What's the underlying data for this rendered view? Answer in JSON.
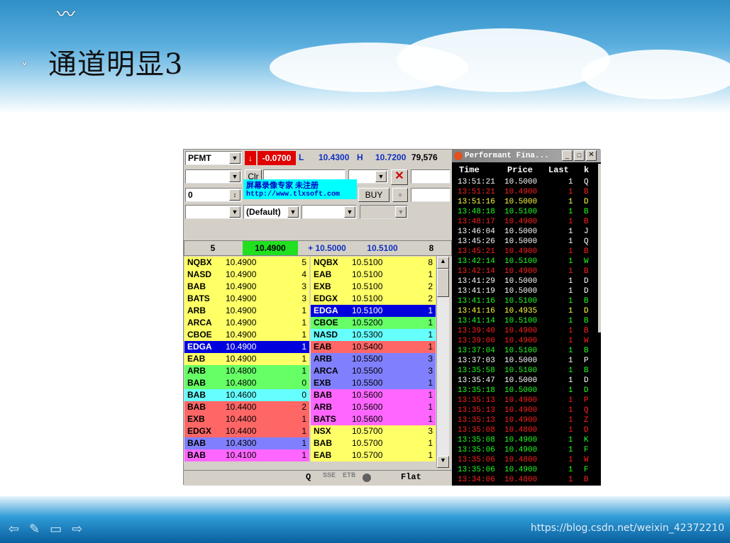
{
  "slide": {
    "title": "通道明显3",
    "watermark": "https://blog.csdn.net/weixin_42372210"
  },
  "ticker": {
    "symbol": "PFMT",
    "change": "-0.0700",
    "low_label": "L",
    "low": "10.4300",
    "high_label": "H",
    "high": "10.7200",
    "volume": "79,576"
  },
  "order": {
    "clr": "Clr",
    "qty": "0",
    "buy": "BUY",
    "plus": "+",
    "route": "(Default)",
    "overlay_line1": "屏幕录像专家      未注册",
    "overlay_line2": "http://www.tlxsoft.com"
  },
  "level1": {
    "bid_size": "5",
    "bid": "10.4900",
    "ask_label": "+ 10.5000",
    "ask": "10.5100",
    "ask_size": "8"
  },
  "bids": [
    {
      "mm": "NQBX",
      "price": "10.4900",
      "size": "5",
      "bg": "#ffff66"
    },
    {
      "mm": "NASD",
      "price": "10.4900",
      "size": "4",
      "bg": "#ffff66"
    },
    {
      "mm": "BAB",
      "price": "10.4900",
      "size": "3",
      "bg": "#ffff66"
    },
    {
      "mm": "BATS",
      "price": "10.4900",
      "size": "3",
      "bg": "#ffff66"
    },
    {
      "mm": "ARB",
      "price": "10.4900",
      "size": "1",
      "bg": "#ffff66"
    },
    {
      "mm": "ARCA",
      "price": "10.4900",
      "size": "1",
      "bg": "#ffff66"
    },
    {
      "mm": "CBOE",
      "price": "10.4900",
      "size": "1",
      "bg": "#ffff66"
    },
    {
      "mm": "EDGA",
      "price": "10.4900",
      "size": "1",
      "bg": "#0000dd",
      "fg": "#ffffff"
    },
    {
      "mm": "EAB",
      "price": "10.4900",
      "size": "1",
      "bg": "#ffff66"
    },
    {
      "mm": "ARB",
      "price": "10.4800",
      "size": "1",
      "bg": "#66ff66"
    },
    {
      "mm": "BAB",
      "price": "10.4800",
      "size": "0",
      "bg": "#66ff66"
    },
    {
      "mm": "BAB",
      "price": "10.4600",
      "size": "0",
      "bg": "#66ffff"
    },
    {
      "mm": "BAB",
      "price": "10.4400",
      "size": "2",
      "bg": "#ff6666"
    },
    {
      "mm": "EXB",
      "price": "10.4400",
      "size": "1",
      "bg": "#ff6666"
    },
    {
      "mm": "EDGX",
      "price": "10.4400",
      "size": "1",
      "bg": "#ff6666"
    },
    {
      "mm": "BAB",
      "price": "10.4300",
      "size": "1",
      "bg": "#8080ff"
    },
    {
      "mm": "BAB",
      "price": "10.4100",
      "size": "1",
      "bg": "#ff66ff"
    }
  ],
  "asks": [
    {
      "mm": "NQBX",
      "price": "10.5100",
      "size": "8",
      "bg": "#ffff66"
    },
    {
      "mm": "EAB",
      "price": "10.5100",
      "size": "1",
      "bg": "#ffff66"
    },
    {
      "mm": "EXB",
      "price": "10.5100",
      "size": "2",
      "bg": "#ffff66"
    },
    {
      "mm": "EDGX",
      "price": "10.5100",
      "size": "2",
      "bg": "#ffff66"
    },
    {
      "mm": "EDGA",
      "price": "10.5100",
      "size": "1",
      "bg": "#0000dd",
      "fg": "#ffffff"
    },
    {
      "mm": "CBOE",
      "price": "10.5200",
      "size": "1",
      "bg": "#66ff66"
    },
    {
      "mm": "NASD",
      "price": "10.5300",
      "size": "1",
      "bg": "#66ffff"
    },
    {
      "mm": "EAB",
      "price": "10.5400",
      "size": "1",
      "bg": "#ff6666"
    },
    {
      "mm": "ARB",
      "price": "10.5500",
      "size": "3",
      "bg": "#8080ff"
    },
    {
      "mm": "ARCA",
      "price": "10.5500",
      "size": "3",
      "bg": "#8080ff"
    },
    {
      "mm": "EXB",
      "price": "10.5500",
      "size": "1",
      "bg": "#8080ff"
    },
    {
      "mm": "BAB",
      "price": "10.5600",
      "size": "1",
      "bg": "#ff66ff"
    },
    {
      "mm": "ARB",
      "price": "10.5600",
      "size": "1",
      "bg": "#ff66ff"
    },
    {
      "mm": "BATS",
      "price": "10.5600",
      "size": "1",
      "bg": "#ff66ff"
    },
    {
      "mm": "NSX",
      "price": "10.5700",
      "size": "3",
      "bg": "#ffff66"
    },
    {
      "mm": "BAB",
      "price": "10.5700",
      "size": "1",
      "bg": "#ffff66"
    },
    {
      "mm": "EAB",
      "price": "10.5700",
      "size": "1",
      "bg": "#ffff66"
    }
  ],
  "status": {
    "q": "Q",
    "sse": "SSE",
    "etb": "ETB",
    "flat": "Flat"
  },
  "tas": {
    "title": "Performant Fina...",
    "col_time": "Time",
    "col_price": "Price",
    "col_last": "Last",
    "col_k": "k",
    "rows": [
      {
        "t": "13:51:21",
        "p": "10.5000",
        "s": "1",
        "k": "Q",
        "c": "#ffffff"
      },
      {
        "t": "13:51:21",
        "p": "10.4900",
        "s": "1",
        "k": "B",
        "c": "#ff2020"
      },
      {
        "t": "13:51:16",
        "p": "10.5000",
        "s": "1",
        "k": "D",
        "c": "#ffff40"
      },
      {
        "t": "13:48:18",
        "p": "10.5100",
        "s": "1",
        "k": "B",
        "c": "#20ff20"
      },
      {
        "t": "13:48:17",
        "p": "10.4900",
        "s": "1",
        "k": "B",
        "c": "#ff2020"
      },
      {
        "t": "13:46:04",
        "p": "10.5000",
        "s": "1",
        "k": "J",
        "c": "#ffffff"
      },
      {
        "t": "13:45:26",
        "p": "10.5000",
        "s": "1",
        "k": "Q",
        "c": "#ffffff"
      },
      {
        "t": "13:45:21",
        "p": "10.4900",
        "s": "1",
        "k": "B",
        "c": "#ff2020"
      },
      {
        "t": "13:42:14",
        "p": "10.5100",
        "s": "1",
        "k": "W",
        "c": "#20ff20"
      },
      {
        "t": "13:42:14",
        "p": "10.4900",
        "s": "1",
        "k": "B",
        "c": "#ff2020"
      },
      {
        "t": "13:41:29",
        "p": "10.5000",
        "s": "1",
        "k": "D",
        "c": "#ffffff"
      },
      {
        "t": "13:41:19",
        "p": "10.5000",
        "s": "1",
        "k": "D",
        "c": "#ffffff"
      },
      {
        "t": "13:41:16",
        "p": "10.5100",
        "s": "1",
        "k": "B",
        "c": "#20ff20"
      },
      {
        "t": "13:41:16",
        "p": "10.4935",
        "s": "1",
        "k": "D",
        "c": "#ffff40"
      },
      {
        "t": "13:41:14",
        "p": "10.5100",
        "s": "1",
        "k": "B",
        "c": "#20ff20"
      },
      {
        "t": "13:39:40",
        "p": "10.4900",
        "s": "1",
        "k": "B",
        "c": "#ff2020"
      },
      {
        "t": "13:39:00",
        "p": "10.4900",
        "s": "1",
        "k": "W",
        "c": "#ff2020"
      },
      {
        "t": "13:37:04",
        "p": "10.5100",
        "s": "1",
        "k": "B",
        "c": "#20ff20"
      },
      {
        "t": "13:37:03",
        "p": "10.5000",
        "s": "1",
        "k": "P",
        "c": "#ffffff"
      },
      {
        "t": "13:35:58",
        "p": "10.5100",
        "s": "1",
        "k": "B",
        "c": "#20ff20"
      },
      {
        "t": "13:35:47",
        "p": "10.5000",
        "s": "1",
        "k": "D",
        "c": "#ffffff"
      },
      {
        "t": "13:35:18",
        "p": "10.5000",
        "s": "1",
        "k": "D",
        "c": "#20ff20"
      },
      {
        "t": "13:35:13",
        "p": "10.4900",
        "s": "1",
        "k": "P",
        "c": "#ff2020"
      },
      {
        "t": "13:35:13",
        "p": "10.4900",
        "s": "1",
        "k": "Q",
        "c": "#ff2020"
      },
      {
        "t": "13:35:13",
        "p": "10.4900",
        "s": "1",
        "k": "Z",
        "c": "#ff2020"
      },
      {
        "t": "13:35:08",
        "p": "10.4800",
        "s": "1",
        "k": "D",
        "c": "#ff2020"
      },
      {
        "t": "13:35:08",
        "p": "10.4900",
        "s": "1",
        "k": "K",
        "c": "#20ff20"
      },
      {
        "t": "13:35:06",
        "p": "10.4900",
        "s": "1",
        "k": "F",
        "c": "#20ff20"
      },
      {
        "t": "13:35:06",
        "p": "10.4800",
        "s": "1",
        "k": "W",
        "c": "#ff2020"
      },
      {
        "t": "13:35:06",
        "p": "10.4900",
        "s": "1",
        "k": "F",
        "c": "#20ff20"
      },
      {
        "t": "13:34:06",
        "p": "10.4800",
        "s": "1",
        "k": "B",
        "c": "#ff2020"
      }
    ]
  }
}
